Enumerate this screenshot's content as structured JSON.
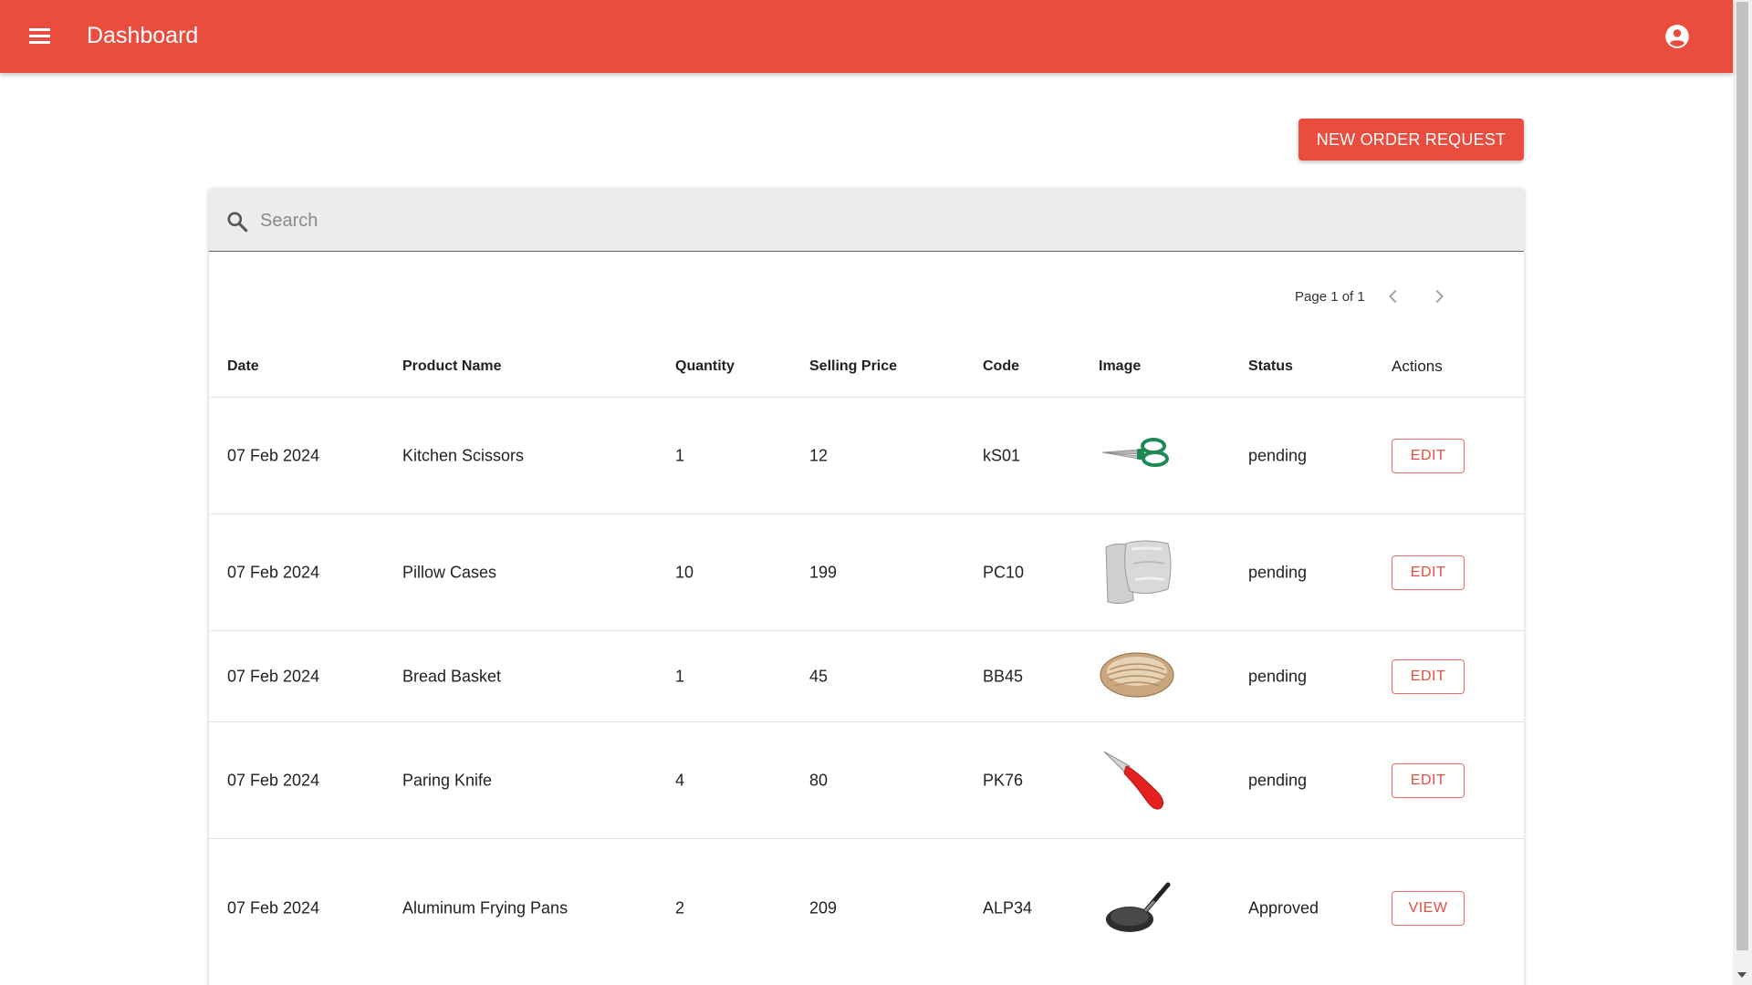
{
  "appbar": {
    "title": "Dashboard"
  },
  "toolbar": {
    "new_order_label": "NEW ORDER REQUEST"
  },
  "search": {
    "placeholder": "Search",
    "value": ""
  },
  "pagination": {
    "text": "Page 1 of 1"
  },
  "table": {
    "headers": {
      "date": "Date",
      "product_name": "Product Name",
      "quantity": "Quantity",
      "selling_price": "Selling Price",
      "code": "Code",
      "image": "Image",
      "status": "Status",
      "actions": "Actions"
    },
    "rows": [
      {
        "date": "07 Feb 2024",
        "product_name": "Kitchen Scissors",
        "quantity": "1",
        "selling_price": "12",
        "code": "kS01",
        "image": "scissors",
        "status": "pending",
        "action": "EDIT"
      },
      {
        "date": "07 Feb 2024",
        "product_name": "Pillow Cases",
        "quantity": "10",
        "selling_price": "199",
        "code": "PC10",
        "image": "pillow",
        "status": "pending",
        "action": "EDIT"
      },
      {
        "date": "07 Feb 2024",
        "product_name": "Bread Basket",
        "quantity": "1",
        "selling_price": "45",
        "code": "BB45",
        "image": "basket",
        "status": "pending",
        "action": "EDIT"
      },
      {
        "date": "07 Feb 2024",
        "product_name": "Paring Knife",
        "quantity": "4",
        "selling_price": "80",
        "code": "PK76",
        "image": "knife",
        "status": "pending",
        "action": "EDIT"
      },
      {
        "date": "07 Feb 2024",
        "product_name": "Aluminum Frying Pans",
        "quantity": "2",
        "selling_price": "209",
        "code": "ALP34",
        "image": "pan",
        "status": "Approved",
        "action": "VIEW"
      }
    ]
  },
  "colors": {
    "primary": "#ea4c3e",
    "outline": "#ea6b60"
  }
}
